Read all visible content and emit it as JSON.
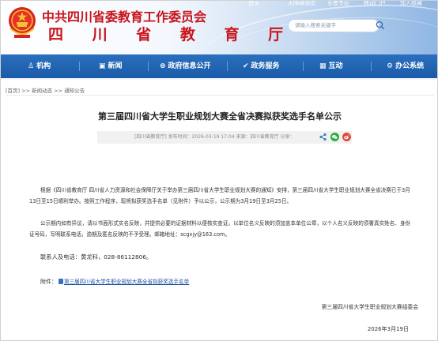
{
  "header": {
    "site_name": "中共四川省委教育工作委员会",
    "site_subname": "四 川 省 教 育 厅",
    "top_links": [
      "首页",
      "无障碍浏览",
      "长者专区",
      "移动门户",
      "加入收藏"
    ],
    "search_placeholder": "请输入搜索关键字",
    "brand_color": "#c8151d"
  },
  "nav": {
    "items": [
      {
        "icon": "institution-icon",
        "label": "机构"
      },
      {
        "icon": "news-icon",
        "label": "新闻"
      },
      {
        "icon": "government-info-icon",
        "label": "政府信息公开"
      },
      {
        "icon": "service-icon",
        "label": "政务服务"
      },
      {
        "icon": "interaction-icon",
        "label": "互动"
      },
      {
        "icon": "office-system-icon",
        "label": "办公系统"
      }
    ],
    "color": "#1a5ba8"
  },
  "breadcrumb": {
    "home": "[首页]",
    "separator": ">>",
    "level1": "新闻动态",
    "level2": "通知公告"
  },
  "article": {
    "title": "第三届四川省大学生职业规划大赛全省决赛拟获奖选手名单公示",
    "meta": "[四川省教育厅]   发布时间：2026-03-19 17:04   来源：四川省教育厅       分享：",
    "share_icons": [
      "share-icon",
      "wechat-icon",
      "weibo-icon"
    ],
    "paragraph1": "根据《四川省教育厅 四川省人力资源和社会保障厅关于举办第三届四川省大学生职业规划大赛的通知》安排，第三届四川省大学生职业规划大赛全省决赛已于3月13日至15日顺利举办。按照工作程序，现将拟获奖选手名单（见附件）予以公示，公示期为3月19日至3月25日。",
    "paragraph2": "公示期内如有异议，请以书面形式实名反映，并提供必要的证据材料以便核实查证。以单位名义反映的须加盖本单位公章，以个人名义反映的须署真实姓名、身份证号码，写明联系电话，逾期及匿名反映的不予受理。邮箱地址：scgxjy@163.com。",
    "contact": "联系人及电话：黄龙科，028-86112806。",
    "attachment_label": "附件：",
    "attachment_link": "第三届四川省大学生职业规划大赛全省拟获奖选手名单",
    "signature": "第三届四川省大学生职业规划大赛组委会",
    "date": "2026年3月19日"
  }
}
